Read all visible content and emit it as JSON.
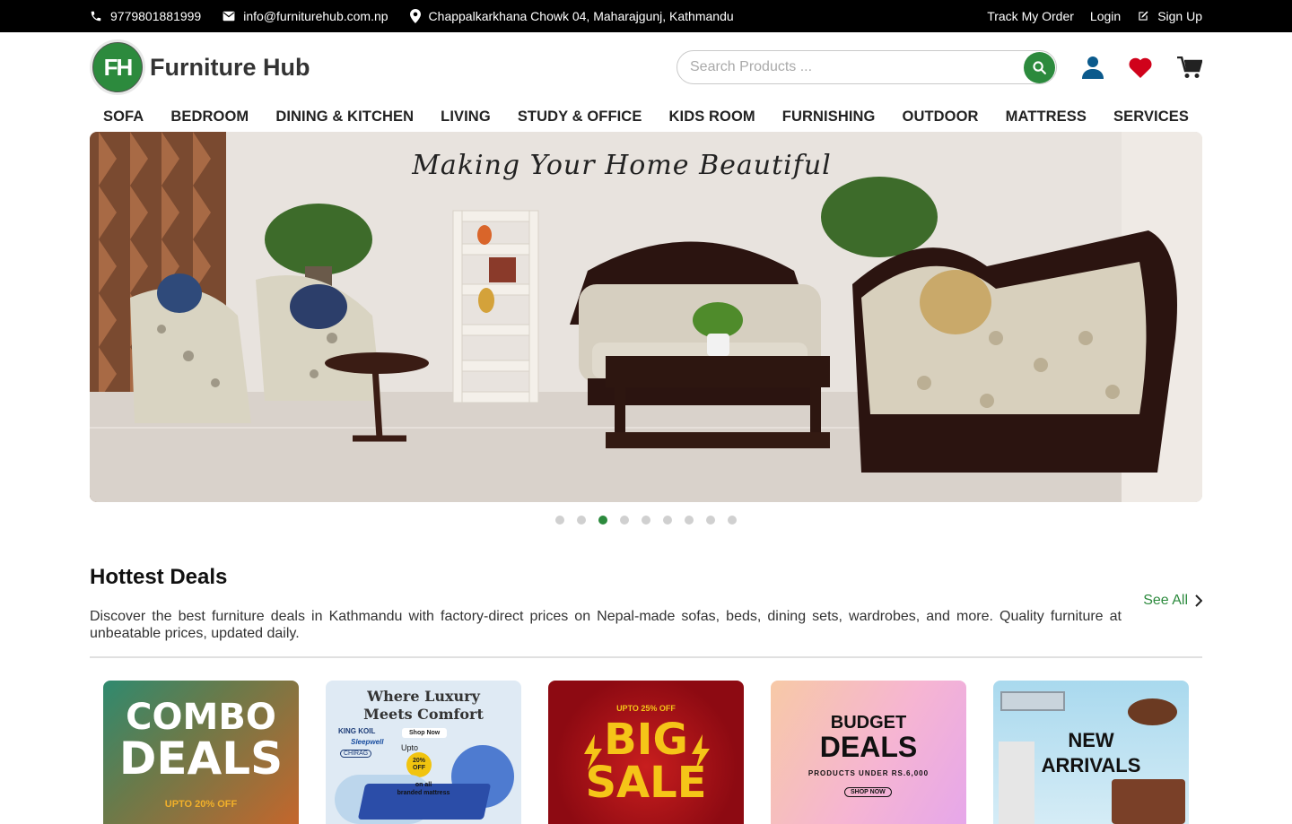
{
  "topbar": {
    "phone": "9779801881999",
    "email": "info@furniturehub.com.np",
    "address": "Chappalkarkhana Chowk 04, Maharajgunj, Kathmandu",
    "track_order": "Track My Order",
    "login": "Login",
    "signup": "Sign Up"
  },
  "logo": {
    "mark": "FH",
    "name": "Furniture Hub"
  },
  "search": {
    "placeholder": "Search Products ..."
  },
  "nav": [
    "SOFA",
    "BEDROOM",
    "DINING & KITCHEN",
    "LIVING",
    "STUDY & OFFICE",
    "KIDS ROOM",
    "FURNISHING",
    "OUTDOOR",
    "MATTRESS",
    "SERVICES"
  ],
  "hero": {
    "tagline": "Making Your Home Beautiful",
    "slide_count": 9,
    "active_slide": 3
  },
  "deals": {
    "title": "Hottest Deals",
    "description": "Discover the best furniture deals in Kathmandu with factory-direct prices on Nepal-made sofas, beds, dining sets, wardrobes, and more. Quality furniture at unbeatable prices, updated daily.",
    "see_all": "See All"
  },
  "cards": {
    "c1": {
      "line1": "COMBO",
      "line2": "DEALS",
      "sub": "UPTO 20% OFF"
    },
    "c2": {
      "line1": "Where Luxury",
      "line2": "Meets Comfort",
      "brand1": "KING KOIL",
      "brand2": "Sleepwell",
      "brand3": "CHIRAG",
      "shop": "Shop Now",
      "upto": "Upto",
      "pct": "20%",
      "off": "OFF",
      "foot1": "on all",
      "foot2": "branded mattress"
    },
    "c3": {
      "badge": "UPTO 25% OFF",
      "line1": "BIG",
      "line2": "SALE"
    },
    "c4": {
      "line1": "BUDGET",
      "line2": "DEALS",
      "sub": "PRODUCTS UNDER RS.6,000",
      "shop": "SHOP NOW"
    },
    "c5": {
      "line1": "NEW",
      "line2": "ARRIVALS"
    }
  },
  "colors": {
    "brand_green": "#2c8a3d",
    "heart_red": "#d0021b",
    "user_blue": "#0b5a8c"
  }
}
